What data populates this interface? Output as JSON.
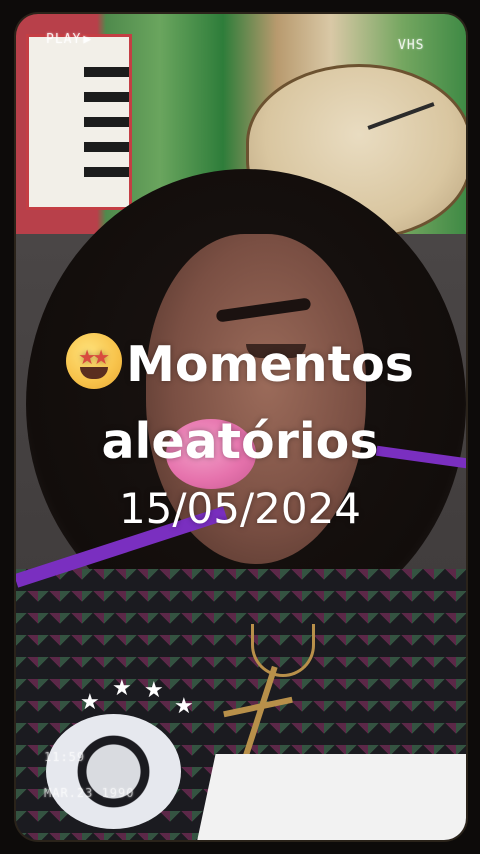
{
  "overlay": {
    "play_text": "PLAY",
    "play_icon": "play-icon",
    "format_text": "VHS",
    "time_text": "11:59",
    "date_text": "MAR.23 1990"
  },
  "caption": {
    "emoji": "star-struck-emoji",
    "line1": "Momentos",
    "line2": "aleatórios",
    "date": "15/05/2024"
  },
  "colors": {
    "lip_pink": "#e673ad",
    "jersey_stripe": "#7a2fc0",
    "chain_gold": "#b8904a",
    "text_white": "#ffffff"
  }
}
